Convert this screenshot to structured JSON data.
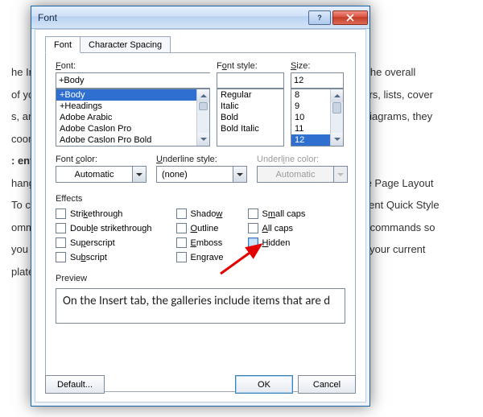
{
  "dialog": {
    "title": "Font",
    "tabs": {
      "font": "Font",
      "spacing": "Character Spacing"
    },
    "labels": {
      "font": "Font:",
      "font_style": "Font style:",
      "size": "Size:",
      "font_color": "Font color:",
      "underline_style": "Underline style:",
      "underline_color": "Underline color:",
      "effects": "Effects",
      "preview": "Preview"
    },
    "font_field": "+Body",
    "font_list": [
      "+Body",
      "+Headings",
      "Adobe Arabic",
      "Adobe Caslon Pro",
      "Adobe Caslon Pro Bold"
    ],
    "font_style_field": "",
    "font_style_list": [
      "Regular",
      "Italic",
      "Bold",
      "Bold Italic"
    ],
    "size_field": "12",
    "size_list": [
      "8",
      "9",
      "10",
      "11",
      "12"
    ],
    "font_color": "Automatic",
    "underline_style": "(none)",
    "underline_color": "Automatic",
    "effects": {
      "strikethrough": "Strikethrough",
      "double_strikethrough": "Double strikethrough",
      "superscript": "Superscript",
      "subscript": "Subscript",
      "shadow": "Shadow",
      "outline": "Outline",
      "emboss": "Emboss",
      "engrave": "Engrave",
      "small_caps": "Small caps",
      "all_caps": "All caps",
      "hidden": "Hidden"
    },
    "preview_text": "On the Insert tab, the galleries include items that are d",
    "buttons": {
      "default": "Default...",
      "ok": "OK",
      "cancel": "Cancel"
    }
  },
  "background": {
    "p1": "he Insert tab, the galleries include items that are designed to coordinate with the overall",
    "p2": "of your document. You can use these galleries to insert tables, headers, footers, lists, cover",
    "p3": "s, and other document building blocks. When you create pictures, charts, or diagrams, they",
    "p4": "coordinate with your current document look.",
    "p5": ": enter regular text here",
    "p6": "hange the overall look of your document, choose new Theme elements on the Page Layout",
    "p7": "To change the looks available in the Quick Style gallery, use the Change Current Quick Style",
    "p8": "ommand. Both the Themes gallery and the Quick Styles gallery provide reset commands so",
    "p9": "you can always restore the look of your document to the original contained in your current",
    "p10": "plate."
  }
}
